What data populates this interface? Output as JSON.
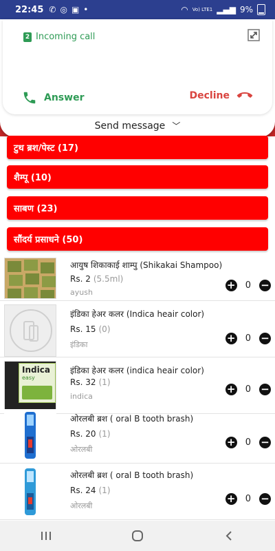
{
  "status": {
    "time": "22:45",
    "battery": "9%",
    "network": "Vo) LTE1"
  },
  "call": {
    "sim": "2",
    "title": "Incoming call",
    "answer": "Answer",
    "decline": "Decline",
    "send_message": "Send message"
  },
  "categories": [
    {
      "label": "टुथ ब्रश/पेस्ट (17)"
    },
    {
      "label": "शैम्पू (10)"
    },
    {
      "label": "साबण (23)"
    },
    {
      "label": "सौंदर्य प्रसाधने (50)"
    }
  ],
  "products": [
    {
      "name": "आयुष शिकाकाई शाम्पु (Shikakai Shampoo)",
      "price": "Rs. 2",
      "unit": "(5.5ml)",
      "brand": "ayush",
      "qty": "0"
    },
    {
      "name": "इंडिका हेअर कलर (Indica heair color)",
      "price": "Rs. 15",
      "unit": "(0)",
      "brand": "इंडिका",
      "qty": "0"
    },
    {
      "name": "इंडिका हेअर कलर (indica heair color)",
      "price": "Rs. 32",
      "unit": "(1)",
      "brand": "indica",
      "qty": "0"
    },
    {
      "name": "ओरलबी ब्रश ( oral B tooth brash)",
      "price": "Rs. 20",
      "unit": "(1)",
      "brand": "ओरलबी",
      "qty": "0"
    },
    {
      "name": "ओरलबी ब्रश ( oral B tooth brash)",
      "price": "Rs. 24",
      "unit": "(1)",
      "brand": "ओरलबी",
      "qty": "0"
    }
  ],
  "thumb_texts": {
    "indica": "Indica",
    "indica_sub": "easy"
  },
  "colors": {
    "accent_red": "#ff0000",
    "call_green": "#2e9b55",
    "decline_red": "#d9443f",
    "status_blue": "#2c3f8f"
  }
}
